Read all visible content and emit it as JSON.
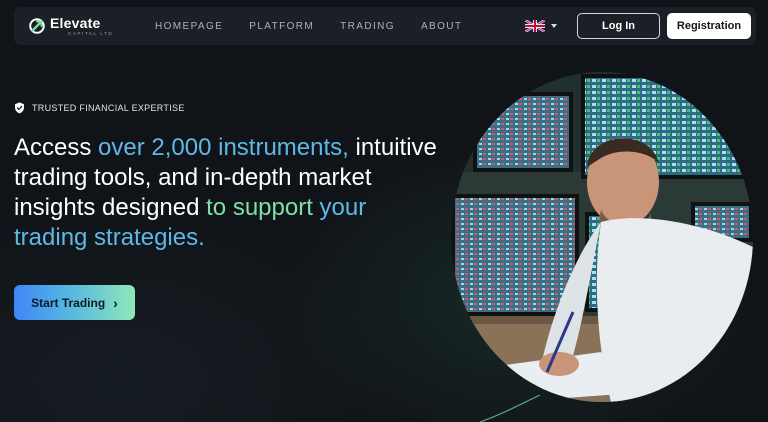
{
  "brand": {
    "name": "Elevate",
    "tagline": "CAPITAL LTD",
    "logo_icon": "elevate-logo-icon"
  },
  "nav": {
    "links": [
      "HOMEPAGE",
      "PLATFORM",
      "TRADING",
      "ABOUT"
    ],
    "language_icon": "uk-flag-icon",
    "login_label": "Log In",
    "register_label": "Registration"
  },
  "hero": {
    "badge_text": "TRUSTED FINANCIAL EXPERTISE",
    "badge_icon": "shield-check-icon",
    "headline": {
      "part1": "Access ",
      "part2": "over 2,000 instruments,",
      "part3": " intuitive trading tools, and in-depth market insights designed ",
      "part4": "to support",
      "part5": " ",
      "part6": "your trading strategies."
    },
    "cta_label": "Start Trading",
    "cta_icon": "chevron-right-icon",
    "image": "trader-at-trading-desk-photo"
  },
  "colors": {
    "background": "#101418",
    "accent_blue": "#5fb8e6",
    "accent_green": "#7fe0a3",
    "nav_bg": "#1b2026"
  }
}
